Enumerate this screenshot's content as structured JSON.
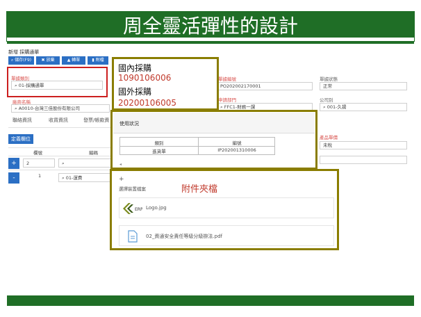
{
  "slide_title": "周全靈活彈性的設計",
  "form": {
    "title": "新增 採購通單",
    "toolbar": {
      "save_label": "儲存(F9)",
      "discard_label": "放棄",
      "transfer_label": "轉單",
      "attach_label": "附檔"
    },
    "fields": {
      "category_label": "單據類別",
      "category_value": "01-採購通單",
      "vendor_label": "廠商名稱",
      "vendor_value": "A0010-台灣三佳股份有限公司",
      "number_label": "單據編號",
      "number_value": "PO202002170001",
      "dept_label": "申請部門",
      "dept_value": "FFC1-財務一課",
      "status_label": "單據狀態",
      "status_value": "正常",
      "company_label": "公司別",
      "company_value": "001-久揚",
      "product_label": "產品單價",
      "product_value": "未稅"
    },
    "tabs": [
      "聯絡資訊",
      "收貨資訊",
      "發票/帳款資"
    ],
    "define_cols_label": "定義欄位",
    "grid": {
      "col_seq": "欄號",
      "col_code": "編碼",
      "rows": [
        {
          "seq": "2",
          "code": ""
        },
        {
          "seq": "1",
          "code": "01-運費"
        }
      ]
    }
  },
  "callout_purchase": {
    "domestic_label": "國內採購",
    "domestic_number": "1090106006",
    "foreign_label": "國外採購",
    "foreign_number": "20200106005"
  },
  "usage_panel": {
    "title": "使用狀況",
    "headers": [
      "類別",
      "編號"
    ],
    "row": [
      "進貨單",
      "IP202001310006"
    ]
  },
  "attach_panel": {
    "plus": "+",
    "choose_label": "選擇裝置檔案",
    "heading": "附件夾檔",
    "files": [
      "Logo.jpg",
      "02_資通安全責任等級分級辦法.pdf"
    ],
    "colors": {
      "heading": "#c0392b"
    }
  },
  "colors": {
    "green": "#1f6e26",
    "olive": "#8a7d00",
    "highlight_red": "#cc1f1f",
    "number_red": "#c0392b",
    "button_blue": "#2b6fc4"
  }
}
